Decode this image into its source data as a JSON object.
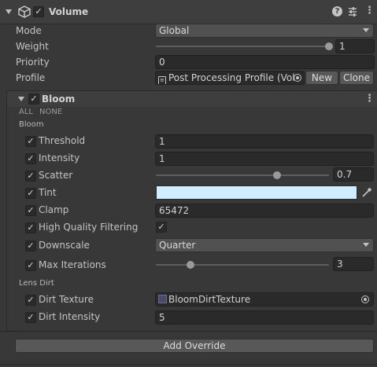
{
  "component": {
    "title": "Volume",
    "enabled_check": "✓"
  },
  "header_icons": [
    "help-icon",
    "preset-icon",
    "kebab-menu-icon"
  ],
  "volume": {
    "mode": {
      "label": "Mode",
      "value": "Global"
    },
    "weight": {
      "label": "Weight",
      "value": "1",
      "fraction": 1.0
    },
    "priority": {
      "label": "Priority",
      "value": "0"
    },
    "profile": {
      "label": "Profile",
      "value": "Post Processing Profile (Vol",
      "new_label": "New",
      "clone_label": "Clone"
    }
  },
  "bloom": {
    "title": "Bloom",
    "all_label": "ALL",
    "none_label": "NONE",
    "section_bloom": "Bloom",
    "section_lens_dirt": "Lens Dirt",
    "threshold": {
      "label": "Threshold",
      "value": "1"
    },
    "intensity": {
      "label": "Intensity",
      "value": "1"
    },
    "scatter": {
      "label": "Scatter",
      "value": "0.7",
      "fraction": 0.7
    },
    "tint": {
      "label": "Tint",
      "color": "#d0eeff"
    },
    "clamp": {
      "label": "Clamp",
      "value": "65472"
    },
    "hq_filtering": {
      "label": "High Quality Filtering",
      "checked": true
    },
    "downscale": {
      "label": "Downscale",
      "value": "Quarter"
    },
    "max_iterations": {
      "label": "Max Iterations",
      "value": "3",
      "fraction": 0.2
    },
    "dirt_texture": {
      "label": "Dirt Texture",
      "value": "BloomDirtTexture"
    },
    "dirt_intensity": {
      "label": "Dirt Intensity",
      "value": "5"
    }
  },
  "add_override_label": "Add Override",
  "check_glyph": "✓"
}
